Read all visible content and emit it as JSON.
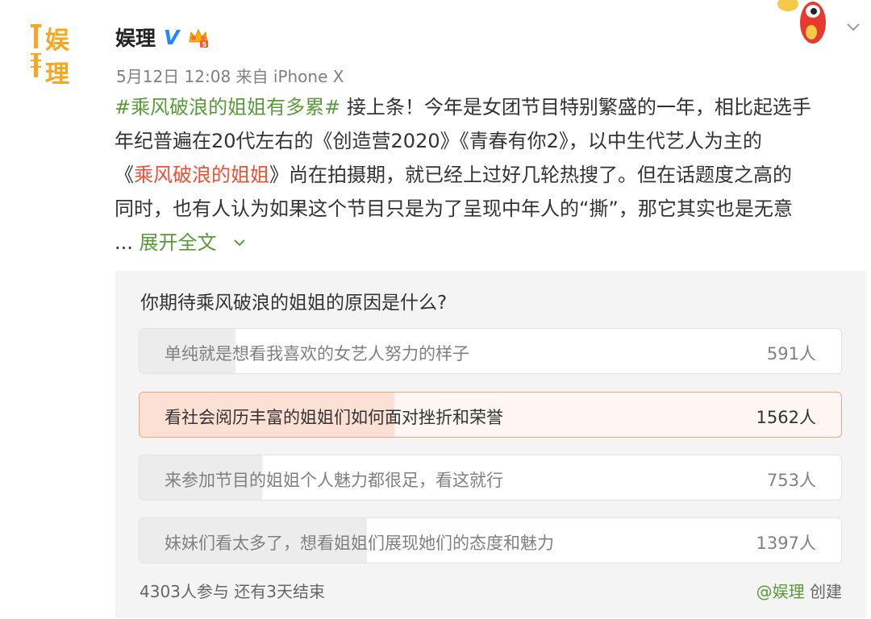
{
  "post": {
    "author": {
      "name": "娱理",
      "verified_badge": "V",
      "avatar_text": [
        "娱",
        "理"
      ]
    },
    "meta": "5月12日 12:08 来自 iPhone X",
    "hashtag": "#乘风破浪的姐姐有多累#",
    "line1_rest": " 接上条！今年是女团节目特别繁盛的一年，相比起选手",
    "line2": "年纪普遍在20代左右的《创造营2020》《青春有你2》，以中生代艺人为主的",
    "line3_open": "《",
    "line3_show": "乘风破浪的姐姐",
    "line3_rest": "》尚在拍摄期，就已经上过好几轮热搜了。但在话题度之高的",
    "line4": "同时，也有人认为如果这个节目只是为了呈现中年人的“撕”，那它其实也是无意",
    "ellipsis": "... ",
    "expand_label": "展开全文"
  },
  "poll": {
    "question": "你期待乘风破浪的姐姐的原因是什么?",
    "options": [
      {
        "label": "单纯就是想看我喜欢的女艺人努力的样子",
        "count": "591人",
        "votes": 591,
        "selected": false
      },
      {
        "label": "看社会阅历丰富的姐姐们如何面对挫折和荣誉",
        "count": "1562人",
        "votes": 1562,
        "selected": true
      },
      {
        "label": "来参加节目的姐姐个人魅力都很足，看这就行",
        "count": "753人",
        "votes": 753,
        "selected": false
      },
      {
        "label": "妹妹们看太多了，想看姐姐们展现她们的态度和魅力",
        "count": "1397人",
        "votes": 1397,
        "selected": false
      }
    ],
    "total_votes": 4303,
    "participants": "4303人参与",
    "remaining": "还有3天结束",
    "creator": "@娱理",
    "created_label": "创建"
  },
  "colors": {
    "hashtag_green": "#589b38",
    "show_red": "#eb5135",
    "verified_blue": "#1e86ff",
    "selected_fill": "#fbe0d3",
    "logo_orange": "#f5a623"
  },
  "icons": {
    "verified": "verified-v-icon",
    "crown": "crown-badge-icon",
    "mascot": "weibo-mascot-icon",
    "more": "chevron-down-icon"
  }
}
